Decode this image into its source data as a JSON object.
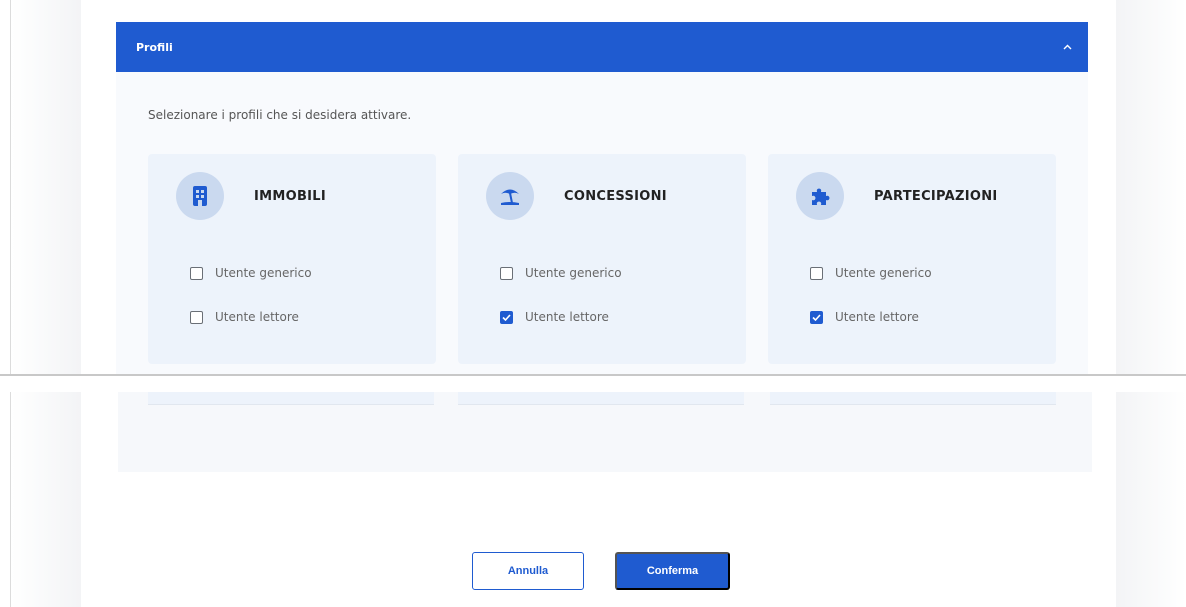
{
  "panel": {
    "title": "Profili",
    "subtitle": "Selezionare i profili che si desidera attivare."
  },
  "cards": [
    {
      "title": "IMMOBILI",
      "icon": "building-icon",
      "options": [
        {
          "label": "Utente generico",
          "checked": false
        },
        {
          "label": "Utente lettore",
          "checked": false
        }
      ]
    },
    {
      "title": "CONCESSIONI",
      "icon": "beach-umbrella-icon",
      "options": [
        {
          "label": "Utente generico",
          "checked": false
        },
        {
          "label": "Utente lettore",
          "checked": true
        }
      ]
    },
    {
      "title": "PARTECIPAZIONI",
      "icon": "puzzle-piece-icon",
      "options": [
        {
          "label": "Utente generico",
          "checked": false
        },
        {
          "label": "Utente lettore",
          "checked": true
        }
      ]
    }
  ],
  "actions": {
    "cancel_label": "Annulla",
    "confirm_label": "Conferma"
  },
  "colors": {
    "primary": "#1f5bd0",
    "card_bg": "#edf3fb",
    "icon_bg": "#cad9ef"
  }
}
